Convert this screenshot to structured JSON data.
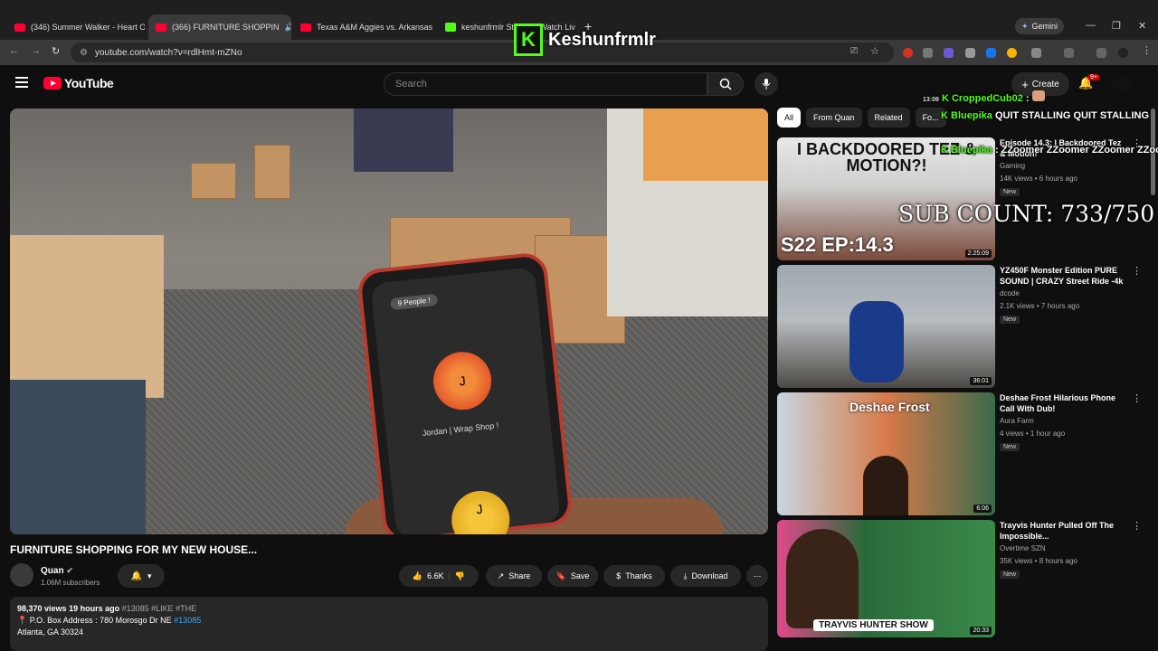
{
  "browser": {
    "tabs": [
      {
        "label": "(346) Summer Walker - Heart O"
      },
      {
        "label": "(366) FURNITURE SHOPPIN"
      },
      {
        "label": "Texas A&M Aggies vs. Arkansas"
      },
      {
        "label": "keshunfrmlr Stream - Watch Liv"
      }
    ],
    "new_tab": "+",
    "gemini_label": "Gemini",
    "url": "youtube.com/watch?v=rdlHmt-mZNo"
  },
  "overlay": {
    "streamer_name": "Keshunfrmlr",
    "sub_count": "SUB COUNT: 733/750",
    "chat": [
      {
        "time": "13:08",
        "user": "CroppedCub02",
        "msg": ":"
      },
      {
        "time": "",
        "user": "Bluepika",
        "msg": "QUIT STALLING QUIT STALLING"
      },
      {
        "time": "",
        "user": "Bluepika",
        "msg": ": ZZoomer ZZoomer ZZoomer ZZoomer"
      }
    ]
  },
  "youtube": {
    "logo_text": "YouTube",
    "search_placeholder": "Search",
    "create_label": "Create",
    "notif_count": "9+",
    "video": {
      "title": "FURNITURE SHOPPING FOR MY NEW HOUSE...",
      "phone_pill": "9 People !",
      "orb_letter": "J",
      "orb_label": "Jordan | Wrap Shop !",
      "orb_letter_2": "J"
    },
    "channel": {
      "name": "Quan",
      "subs": "1.06M subscribers"
    },
    "actions": {
      "likes": "6.6K",
      "share": "Share",
      "save": "Save",
      "thanks": "Thanks",
      "download": "Download"
    },
    "description": {
      "views": "98,370 views",
      "ago": "19 hours ago",
      "tags": "#13085 #LIKE #THE",
      "line2_prefix": "P.O. Box Address : 780 Morosgo Dr NE",
      "line2_tag": "#13085",
      "line3": "Atlanta, GA  30324"
    },
    "chips": [
      "All",
      "From Quan",
      "Related",
      "Fo..."
    ],
    "recommendations": [
      {
        "title": "Episode 14.3: I Backdoored Tez & Motion!",
        "channel": "Gaming",
        "meta": "14K views • 6 hours ago",
        "badge": "New",
        "duration": "2:25:09",
        "thumb_text": "I BACKDOORED TEZ & MOTION?!",
        "thumb_sub": "S22 EP:14.3"
      },
      {
        "title": "YZ450F Monster Edition PURE SOUND | CRAZY Street Ride -4k",
        "channel": "dcode",
        "meta": "2.1K views • 7 hours ago",
        "badge": "New",
        "duration": "36:01",
        "thumb_text": "",
        "thumb_sub": ""
      },
      {
        "title": "Deshae Frost Hilarious Phone Call With Dub!",
        "channel": "Aura Farm",
        "meta": "4 views • 1 hour ago",
        "badge": "New",
        "duration": "6:06",
        "thumb_text": "Deshae Frost",
        "thumb_sub": ""
      },
      {
        "title": "Trayvis Hunter Pulled Off The Impossible...",
        "channel": "Overtime SZN",
        "meta": "35K views • 8 hours ago",
        "badge": "New",
        "duration": "20:33",
        "thumb_text": "TRAYVIS HUNTER SHOW",
        "thumb_sub": ""
      }
    ]
  },
  "colors": {
    "kick_green": "#53fc18",
    "yt_red": "#ff0033",
    "link_blue": "#3ea6ff"
  }
}
